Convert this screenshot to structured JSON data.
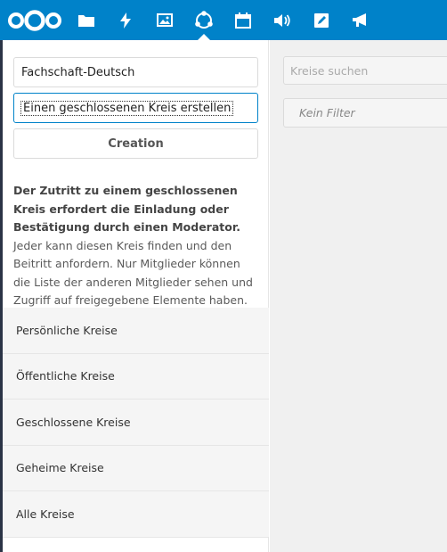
{
  "header": {
    "brand_color": "#0082c9",
    "icons": [
      "nextcloud-logo-icon",
      "files-icon",
      "activity-icon",
      "gallery-icon",
      "circles-icon",
      "calendar-icon",
      "audio-player-icon",
      "notes-icon",
      "announcement-icon"
    ],
    "active_app": "circles-icon"
  },
  "create_form": {
    "name_value": "Fachschaft-Deutsch",
    "type_selected": "Einen geschlossenen Kreis erstellen",
    "create_button_label": "Creation"
  },
  "description": {
    "bold_text": "Der Zutritt zu einem geschlossenen Kreis erfordert die Einladung oder Bestätigung durch einen Moderator.",
    "text": "Jeder kann diesen Kreis finden und den Beitritt anfordern. Nur Mitglieder können die Liste der anderen Mitglieder sehen und Zugriff auf freigegebene Elemente haben."
  },
  "menu": {
    "items": [
      {
        "label": "Persönliche Kreise"
      },
      {
        "label": "Öffentliche Kreise"
      },
      {
        "label": "Geschlossene Kreise"
      },
      {
        "label": "Geheime Kreise"
      },
      {
        "label": "Alle Kreise"
      }
    ]
  },
  "content": {
    "search_placeholder": "Kreise suchen",
    "filter_label": "Kein Filter"
  }
}
